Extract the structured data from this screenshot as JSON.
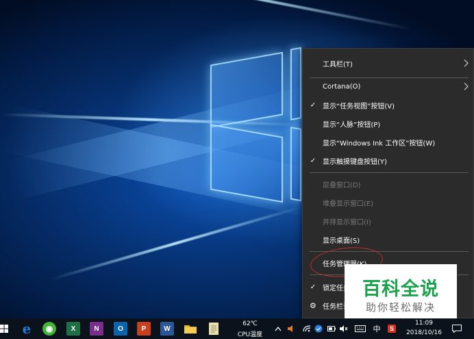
{
  "context_menu": {
    "items": [
      {
        "label": "工具栏(T)",
        "checked": false,
        "disabled": false,
        "submenu": true
      },
      {
        "label": "Cortana(O)",
        "checked": false,
        "disabled": false,
        "submenu": true
      },
      {
        "label": "显示“任务视图”按钮(V)",
        "checked": true,
        "disabled": false
      },
      {
        "label": "显示“人脉”按钮(P)",
        "checked": false,
        "disabled": false
      },
      {
        "label": "显示“Windows Ink 工作区”按钮(W)",
        "checked": false,
        "disabled": false
      },
      {
        "label": "显示触摸键盘按钮(Y)",
        "checked": true,
        "disabled": false
      },
      {
        "label": "层叠窗口(D)",
        "checked": false,
        "disabled": true
      },
      {
        "label": "堆叠显示窗口(E)",
        "checked": false,
        "disabled": true
      },
      {
        "label": "并排显示窗口(I)",
        "checked": false,
        "disabled": true
      },
      {
        "label": "显示桌面(S)",
        "checked": false,
        "disabled": false
      },
      {
        "label": "任务管理器(K)",
        "checked": false,
        "disabled": false
      },
      {
        "label": "锁定任务栏(L)",
        "checked": true,
        "disabled": false
      },
      {
        "label": "任务栏设置(T)",
        "checked": false,
        "disabled": false
      }
    ],
    "check_glyph": "✓",
    "gear_glyph": "⚙"
  },
  "watermark": {
    "title": "百科全说",
    "subtitle": "助你轻松解决"
  },
  "taskbar": {
    "apps": [
      {
        "name": "windows-logo-icon"
      },
      {
        "name": "edge-icon",
        "glyph": "e",
        "color": "#1e78d7"
      },
      {
        "name": "browser-360-icon",
        "glyph": "◉",
        "color": "#43b33a"
      },
      {
        "name": "excel-icon",
        "glyph": "X",
        "color": "#1e7145"
      },
      {
        "name": "onenote-icon",
        "glyph": "N",
        "color": "#7b2d8e"
      },
      {
        "name": "outlook-icon",
        "glyph": "O",
        "color": "#0a64ad"
      },
      {
        "name": "powerpoint-icon",
        "glyph": "P",
        "color": "#c8401e"
      },
      {
        "name": "word-icon",
        "glyph": "W",
        "color": "#2b5797"
      },
      {
        "name": "file-explorer-icon",
        "glyph": "",
        "color": "#e8b533"
      },
      {
        "name": "notepad-icon",
        "glyph": "",
        "color": "#e9dfb0"
      }
    ],
    "cpu_temp": "62℃",
    "cpu_label": "CPU温度",
    "ime": "中",
    "time": "11:09",
    "date": "2018/10/16"
  },
  "colors": {
    "menu_bg": "#2b2b2b",
    "menu_text": "#ffffff",
    "menu_disabled": "#7a7a7a",
    "annotation_ellipse": "#c0302b",
    "watermark_green": "#1aa34a",
    "taskbar_bg": "#0c121c"
  }
}
